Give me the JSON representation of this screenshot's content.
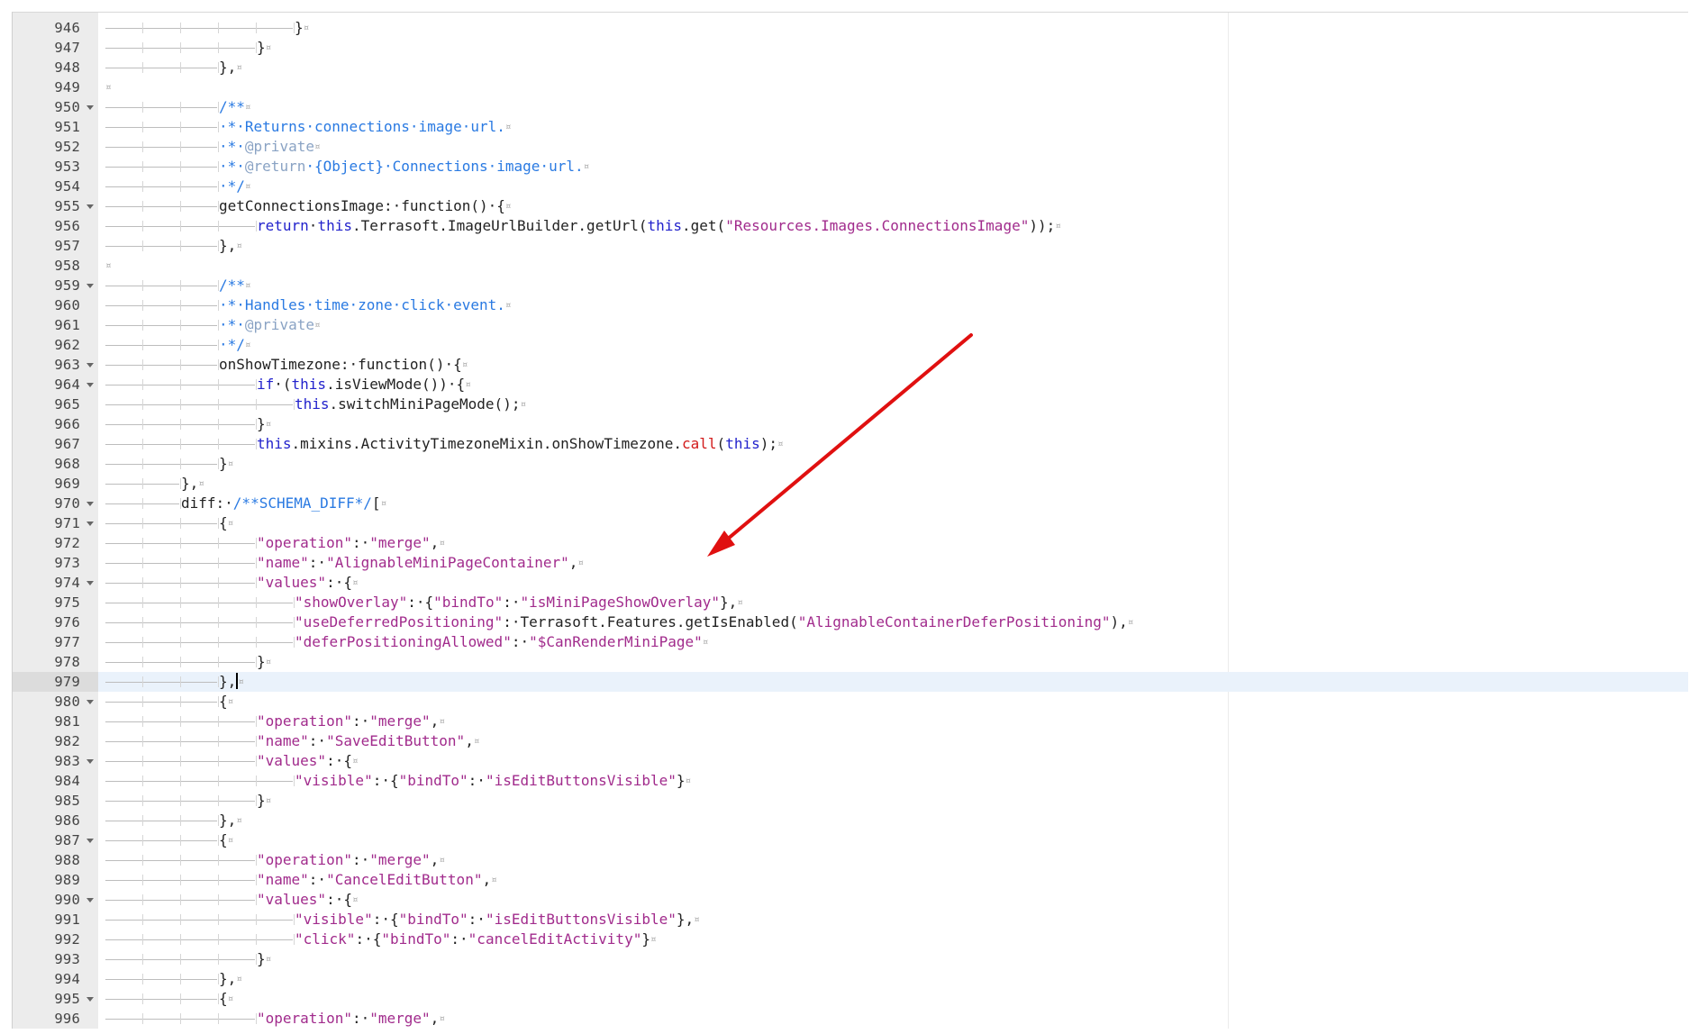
{
  "editor": {
    "active_line": "979",
    "theme": {
      "comment": "#2a7ae2",
      "doctag": "#8aa3c4",
      "keyword": "#2222cc",
      "string": "#a12b8c",
      "call": "#d21a1a",
      "plain": "#222222",
      "annotation_arrow": "#e01010"
    },
    "lines": [
      {
        "n": "946",
        "fold": false,
        "indent": 5,
        "tokens": [
          {
            "t": "}",
            "c": "plain"
          }
        ]
      },
      {
        "n": "947",
        "fold": false,
        "indent": 4,
        "tokens": [
          {
            "t": "}",
            "c": "plain"
          }
        ]
      },
      {
        "n": "948",
        "fold": false,
        "indent": 3,
        "tokens": [
          {
            "t": "},",
            "c": "plain"
          }
        ]
      },
      {
        "n": "949",
        "fold": false,
        "indent": 0,
        "tokens": []
      },
      {
        "n": "950",
        "fold": true,
        "indent": 3,
        "tokens": [
          {
            "t": "/**",
            "c": "comment"
          }
        ]
      },
      {
        "n": "951",
        "fold": false,
        "indent": 3,
        "tokens": [
          {
            "t": "·*·Returns·connections·image·url.",
            "c": "comment"
          }
        ]
      },
      {
        "n": "952",
        "fold": false,
        "indent": 3,
        "tokens": [
          {
            "t": "·*·",
            "c": "comment"
          },
          {
            "t": "@private",
            "c": "doctag"
          }
        ]
      },
      {
        "n": "953",
        "fold": false,
        "indent": 3,
        "tokens": [
          {
            "t": "·*·",
            "c": "comment"
          },
          {
            "t": "@return",
            "c": "doctag"
          },
          {
            "t": "·{Object}·Connections·image·url.",
            "c": "comment"
          }
        ]
      },
      {
        "n": "954",
        "fold": false,
        "indent": 3,
        "tokens": [
          {
            "t": "·*/",
            "c": "comment"
          }
        ]
      },
      {
        "n": "955",
        "fold": true,
        "indent": 3,
        "tokens": [
          {
            "t": "getConnectionsImage:·function()·{",
            "c": "plain"
          }
        ]
      },
      {
        "n": "956",
        "fold": false,
        "indent": 4,
        "tokens": [
          {
            "t": "return",
            "c": "keyword"
          },
          {
            "t": "·",
            "c": "plain"
          },
          {
            "t": "this",
            "c": "keyword"
          },
          {
            "t": ".Terrasoft.ImageUrlBuilder.getUrl(",
            "c": "plain"
          },
          {
            "t": "this",
            "c": "keyword"
          },
          {
            "t": ".get(",
            "c": "plain"
          },
          {
            "t": "\"Resources.Images.ConnectionsImage\"",
            "c": "string"
          },
          {
            "t": "));",
            "c": "plain"
          }
        ]
      },
      {
        "n": "957",
        "fold": false,
        "indent": 3,
        "tokens": [
          {
            "t": "},",
            "c": "plain"
          }
        ]
      },
      {
        "n": "958",
        "fold": false,
        "indent": 0,
        "tokens": []
      },
      {
        "n": "959",
        "fold": true,
        "indent": 3,
        "tokens": [
          {
            "t": "/**",
            "c": "comment"
          }
        ]
      },
      {
        "n": "960",
        "fold": false,
        "indent": 3,
        "tokens": [
          {
            "t": "·*·Handles·time·zone·click·event.",
            "c": "comment"
          }
        ]
      },
      {
        "n": "961",
        "fold": false,
        "indent": 3,
        "tokens": [
          {
            "t": "·*·",
            "c": "comment"
          },
          {
            "t": "@private",
            "c": "doctag"
          }
        ]
      },
      {
        "n": "962",
        "fold": false,
        "indent": 3,
        "tokens": [
          {
            "t": "·*/",
            "c": "comment"
          }
        ]
      },
      {
        "n": "963",
        "fold": true,
        "indent": 3,
        "tokens": [
          {
            "t": "onShowTimezone:·function()·{",
            "c": "plain"
          }
        ]
      },
      {
        "n": "964",
        "fold": true,
        "indent": 4,
        "tokens": [
          {
            "t": "if",
            "c": "keyword"
          },
          {
            "t": "·(",
            "c": "plain"
          },
          {
            "t": "this",
            "c": "keyword"
          },
          {
            "t": ".isViewMode())·{",
            "c": "plain"
          }
        ]
      },
      {
        "n": "965",
        "fold": false,
        "indent": 5,
        "tokens": [
          {
            "t": "this",
            "c": "keyword"
          },
          {
            "t": ".switchMiniPageMode();",
            "c": "plain"
          }
        ]
      },
      {
        "n": "966",
        "fold": false,
        "indent": 4,
        "tokens": [
          {
            "t": "}",
            "c": "plain"
          }
        ]
      },
      {
        "n": "967",
        "fold": false,
        "indent": 4,
        "tokens": [
          {
            "t": "this",
            "c": "keyword"
          },
          {
            "t": ".mixins.ActivityTimezoneMixin.onShowTimezone.",
            "c": "plain"
          },
          {
            "t": "call",
            "c": "call"
          },
          {
            "t": "(",
            "c": "plain"
          },
          {
            "t": "this",
            "c": "keyword"
          },
          {
            "t": ");",
            "c": "plain"
          }
        ]
      },
      {
        "n": "968",
        "fold": false,
        "indent": 3,
        "tokens": [
          {
            "t": "}",
            "c": "plain"
          }
        ]
      },
      {
        "n": "969",
        "fold": false,
        "indent": 2,
        "tokens": [
          {
            "t": "},",
            "c": "plain"
          }
        ]
      },
      {
        "n": "970",
        "fold": true,
        "indent": 2,
        "tokens": [
          {
            "t": "diff:·",
            "c": "plain"
          },
          {
            "t": "/**SCHEMA_DIFF*/",
            "c": "comment"
          },
          {
            "t": "[",
            "c": "plain"
          }
        ]
      },
      {
        "n": "971",
        "fold": true,
        "indent": 3,
        "tokens": [
          {
            "t": "{",
            "c": "plain"
          }
        ]
      },
      {
        "n": "972",
        "fold": false,
        "indent": 4,
        "tokens": [
          {
            "t": "\"operation\"",
            "c": "string"
          },
          {
            "t": ":·",
            "c": "plain"
          },
          {
            "t": "\"merge\"",
            "c": "string"
          },
          {
            "t": ",",
            "c": "plain"
          }
        ]
      },
      {
        "n": "973",
        "fold": false,
        "indent": 4,
        "tokens": [
          {
            "t": "\"name\"",
            "c": "string"
          },
          {
            "t": ":·",
            "c": "plain"
          },
          {
            "t": "\"AlignableMiniPageContainer\"",
            "c": "string"
          },
          {
            "t": ",",
            "c": "plain"
          }
        ]
      },
      {
        "n": "974",
        "fold": true,
        "indent": 4,
        "tokens": [
          {
            "t": "\"values\"",
            "c": "string"
          },
          {
            "t": ":·{",
            "c": "plain"
          }
        ]
      },
      {
        "n": "975",
        "fold": false,
        "indent": 5,
        "tokens": [
          {
            "t": "\"showOverlay\"",
            "c": "string"
          },
          {
            "t": ":·{",
            "c": "plain"
          },
          {
            "t": "\"bindTo\"",
            "c": "string"
          },
          {
            "t": ":·",
            "c": "plain"
          },
          {
            "t": "\"isMiniPageShowOverlay\"",
            "c": "string"
          },
          {
            "t": "},",
            "c": "plain"
          }
        ]
      },
      {
        "n": "976",
        "fold": false,
        "indent": 5,
        "tokens": [
          {
            "t": "\"useDeferredPositioning\"",
            "c": "string"
          },
          {
            "t": ":·Terrasoft.Features.getIsEnabled(",
            "c": "plain"
          },
          {
            "t": "\"AlignableContainerDeferPositioning\"",
            "c": "string"
          },
          {
            "t": "),",
            "c": "plain"
          }
        ]
      },
      {
        "n": "977",
        "fold": false,
        "indent": 5,
        "tokens": [
          {
            "t": "\"deferPositioningAllowed\"",
            "c": "string"
          },
          {
            "t": ":·",
            "c": "plain"
          },
          {
            "t": "\"$CanRenderMiniPage\"",
            "c": "string"
          }
        ]
      },
      {
        "n": "978",
        "fold": false,
        "indent": 4,
        "tokens": [
          {
            "t": "}",
            "c": "plain"
          }
        ]
      },
      {
        "n": "979",
        "fold": false,
        "indent": 3,
        "cursor": true,
        "tokens": [
          {
            "t": "},",
            "c": "plain"
          }
        ]
      },
      {
        "n": "980",
        "fold": true,
        "indent": 3,
        "tokens": [
          {
            "t": "{",
            "c": "plain"
          }
        ]
      },
      {
        "n": "981",
        "fold": false,
        "indent": 4,
        "tokens": [
          {
            "t": "\"operation\"",
            "c": "string"
          },
          {
            "t": ":·",
            "c": "plain"
          },
          {
            "t": "\"merge\"",
            "c": "string"
          },
          {
            "t": ",",
            "c": "plain"
          }
        ]
      },
      {
        "n": "982",
        "fold": false,
        "indent": 4,
        "tokens": [
          {
            "t": "\"name\"",
            "c": "string"
          },
          {
            "t": ":·",
            "c": "plain"
          },
          {
            "t": "\"SaveEditButton\"",
            "c": "string"
          },
          {
            "t": ",",
            "c": "plain"
          }
        ]
      },
      {
        "n": "983",
        "fold": true,
        "indent": 4,
        "tokens": [
          {
            "t": "\"values\"",
            "c": "string"
          },
          {
            "t": ":·{",
            "c": "plain"
          }
        ]
      },
      {
        "n": "984",
        "fold": false,
        "indent": 5,
        "tokens": [
          {
            "t": "\"visible\"",
            "c": "string"
          },
          {
            "t": ":·{",
            "c": "plain"
          },
          {
            "t": "\"bindTo\"",
            "c": "string"
          },
          {
            "t": ":·",
            "c": "plain"
          },
          {
            "t": "\"isEditButtonsVisible\"",
            "c": "string"
          },
          {
            "t": "}",
            "c": "plain"
          }
        ]
      },
      {
        "n": "985",
        "fold": false,
        "indent": 4,
        "tokens": [
          {
            "t": "}",
            "c": "plain"
          }
        ]
      },
      {
        "n": "986",
        "fold": false,
        "indent": 3,
        "tokens": [
          {
            "t": "},",
            "c": "plain"
          }
        ]
      },
      {
        "n": "987",
        "fold": true,
        "indent": 3,
        "tokens": [
          {
            "t": "{",
            "c": "plain"
          }
        ]
      },
      {
        "n": "988",
        "fold": false,
        "indent": 4,
        "tokens": [
          {
            "t": "\"operation\"",
            "c": "string"
          },
          {
            "t": ":·",
            "c": "plain"
          },
          {
            "t": "\"merge\"",
            "c": "string"
          },
          {
            "t": ",",
            "c": "plain"
          }
        ]
      },
      {
        "n": "989",
        "fold": false,
        "indent": 4,
        "tokens": [
          {
            "t": "\"name\"",
            "c": "string"
          },
          {
            "t": ":·",
            "c": "plain"
          },
          {
            "t": "\"CancelEditButton\"",
            "c": "string"
          },
          {
            "t": ",",
            "c": "plain"
          }
        ]
      },
      {
        "n": "990",
        "fold": true,
        "indent": 4,
        "tokens": [
          {
            "t": "\"values\"",
            "c": "string"
          },
          {
            "t": ":·{",
            "c": "plain"
          }
        ]
      },
      {
        "n": "991",
        "fold": false,
        "indent": 5,
        "tokens": [
          {
            "t": "\"visible\"",
            "c": "string"
          },
          {
            "t": ":·{",
            "c": "plain"
          },
          {
            "t": "\"bindTo\"",
            "c": "string"
          },
          {
            "t": ":·",
            "c": "plain"
          },
          {
            "t": "\"isEditButtonsVisible\"",
            "c": "string"
          },
          {
            "t": "},",
            "c": "plain"
          }
        ]
      },
      {
        "n": "992",
        "fold": false,
        "indent": 5,
        "tokens": [
          {
            "t": "\"click\"",
            "c": "string"
          },
          {
            "t": ":·{",
            "c": "plain"
          },
          {
            "t": "\"bindTo\"",
            "c": "string"
          },
          {
            "t": ":·",
            "c": "plain"
          },
          {
            "t": "\"cancelEditActivity\"",
            "c": "string"
          },
          {
            "t": "}",
            "c": "plain"
          }
        ]
      },
      {
        "n": "993",
        "fold": false,
        "indent": 4,
        "tokens": [
          {
            "t": "}",
            "c": "plain"
          }
        ]
      },
      {
        "n": "994",
        "fold": false,
        "indent": 3,
        "tokens": [
          {
            "t": "},",
            "c": "plain"
          }
        ]
      },
      {
        "n": "995",
        "fold": true,
        "indent": 3,
        "tokens": [
          {
            "t": "{",
            "c": "plain"
          }
        ]
      },
      {
        "n": "996",
        "fold": false,
        "indent": 4,
        "tokens": [
          {
            "t": "\"operation\"",
            "c": "string"
          },
          {
            "t": ":·",
            "c": "plain"
          },
          {
            "t": "\"merge\"",
            "c": "string"
          },
          {
            "t": ",",
            "c": "plain"
          }
        ]
      }
    ]
  }
}
